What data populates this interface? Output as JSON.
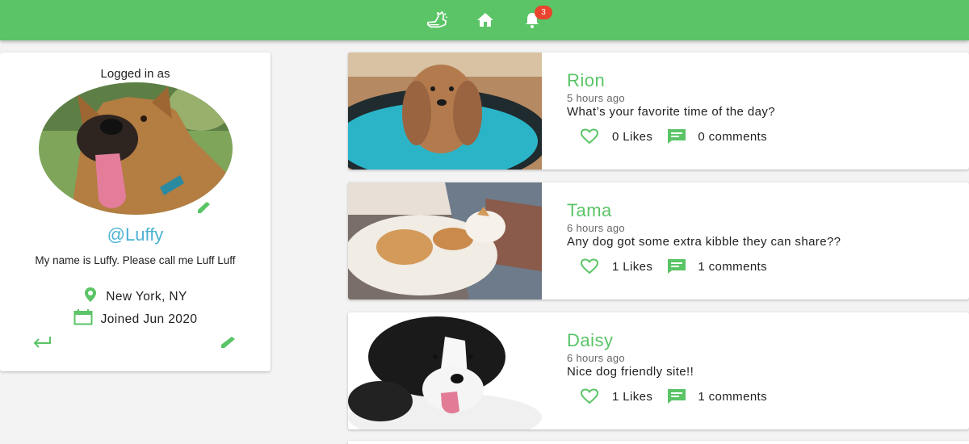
{
  "nav": {
    "icons": [
      "dog-icon",
      "home-icon",
      "bell-icon"
    ],
    "notification_count": "3"
  },
  "profile": {
    "logged_in_label": "Logged in as",
    "username": "@Luffy",
    "bio": "My name is Luffy. Please call me Luff Luff",
    "location": "New York, NY",
    "joined": "Joined Jun 2020"
  },
  "posts": [
    {
      "name": "Rion",
      "time": "5 hours ago",
      "text": "What’s your favorite time of the day?",
      "likes": "0 Likes",
      "comments": "0 comments"
    },
    {
      "name": "Tama",
      "time": "6 hours ago",
      "text": "Any dog got some extra kibble they can share??",
      "likes": "1 Likes",
      "comments": "1 comments"
    },
    {
      "name": "Daisy",
      "time": "6 hours ago",
      "text": "Nice dog friendly site!!",
      "likes": "1 Likes",
      "comments": "1 comments"
    }
  ],
  "colors": {
    "brand": "#5ac466",
    "username": "#4db3d4",
    "badge": "#e9442e"
  }
}
